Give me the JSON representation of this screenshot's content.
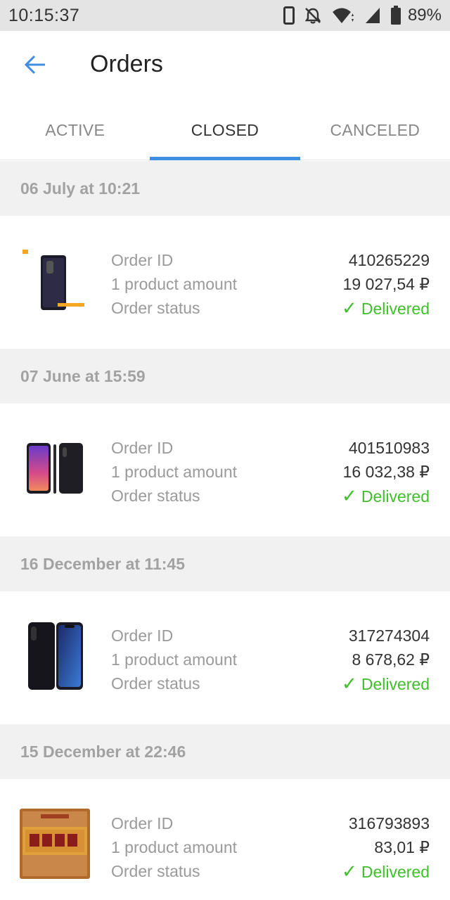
{
  "status_bar": {
    "time": "10:15:37",
    "battery": "89%",
    "icons": [
      "phone-icon",
      "bell-off-icon",
      "wifi-icon",
      "signal-icon",
      "battery-icon"
    ]
  },
  "app_bar": {
    "title": "Orders",
    "back_icon": "arrow-left-icon"
  },
  "tabs": [
    {
      "label": "ACTIVE",
      "active": false
    },
    {
      "label": "CLOSED",
      "active": true
    },
    {
      "label": "CANCELED",
      "active": false
    }
  ],
  "orders": [
    {
      "date": "06 July at 10:21",
      "id_label": "Order ID",
      "amount_label": "1 product amount",
      "status_label": "Order status",
      "order_id": "410265229",
      "amount": "19 027,54 ₽",
      "status": "Delivered",
      "thumb": "phone-thumbnail"
    },
    {
      "date": "07 June at 15:59",
      "id_label": "Order ID",
      "amount_label": "1 product amount",
      "status_label": "Order status",
      "order_id": "401510983",
      "amount": "16 032,38 ₽",
      "status": "Delivered",
      "thumb": "phone-pair-thumbnail"
    },
    {
      "date": "16 December at 11:45",
      "id_label": "Order ID",
      "amount_label": "1 product amount",
      "status_label": "Order status",
      "order_id": "317274304",
      "amount": "8 678,62 ₽",
      "status": "Delivered",
      "thumb": "phone-thumbnail"
    },
    {
      "date": "15 December at 22:46",
      "id_label": "Order ID",
      "amount_label": "1 product amount",
      "status_label": "Order status",
      "order_id": "316793893",
      "amount": "83,01 ₽",
      "status": "Delivered",
      "thumb": "tea-brick-thumbnail"
    }
  ],
  "colors": {
    "accent": "#3f8ee0",
    "delivered": "#3fbf2a",
    "header_bg": "#f1f1f1",
    "status_bar_bg": "#e4e4e4"
  }
}
